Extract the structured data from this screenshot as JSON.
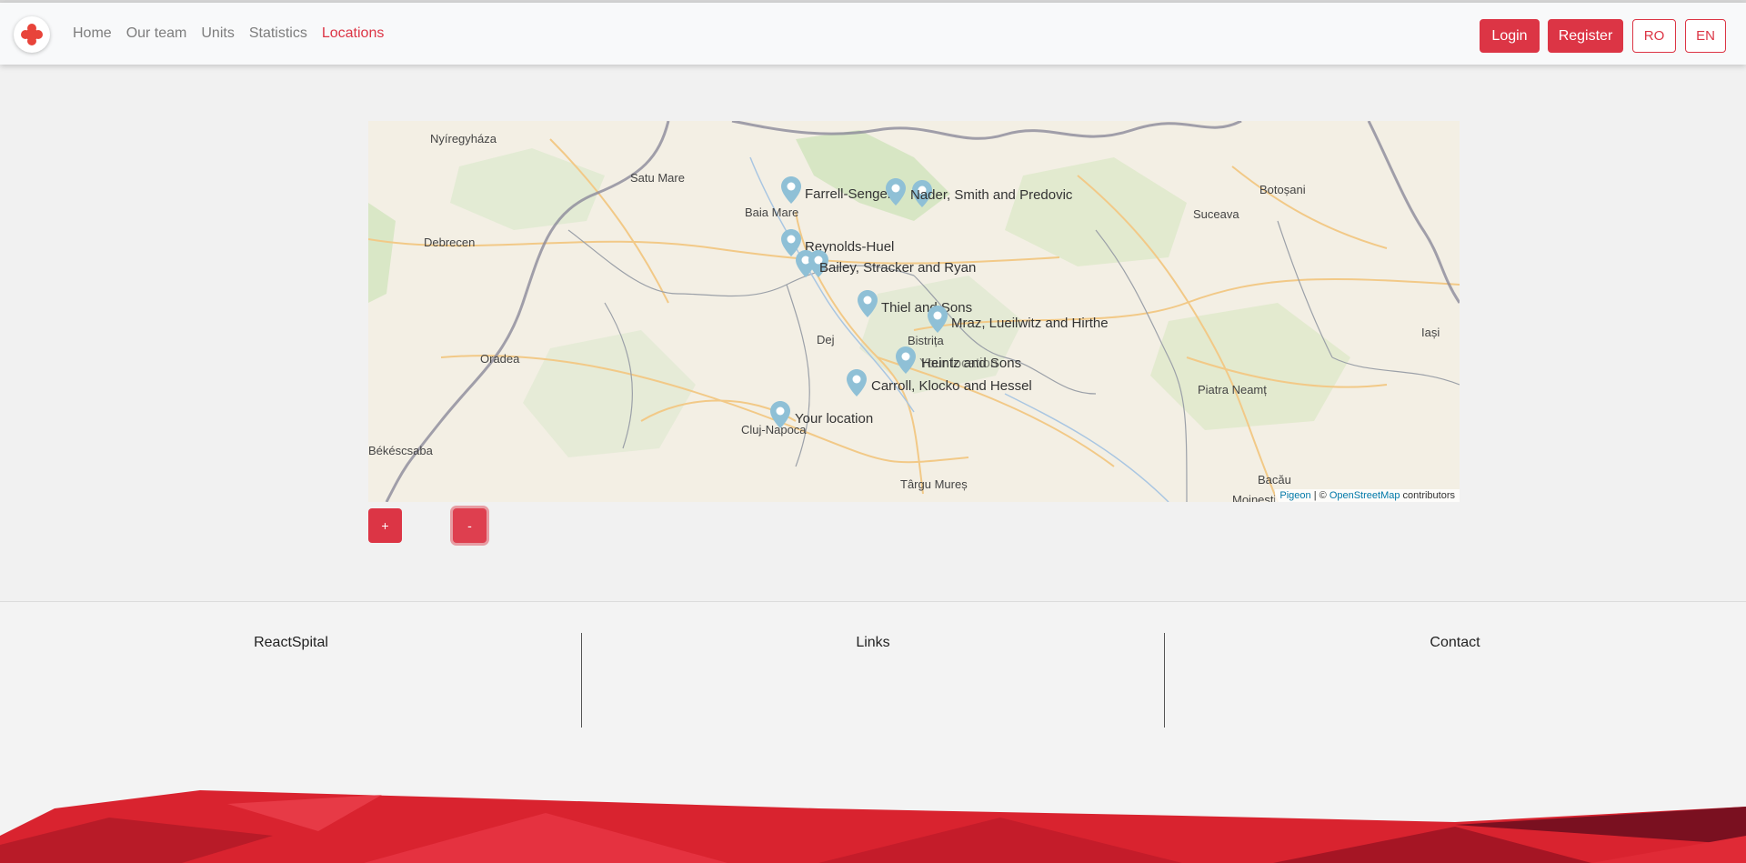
{
  "nav": {
    "links": [
      "Home",
      "Our team",
      "Units",
      "Statistics",
      "Locations"
    ],
    "active_index": 4,
    "login": "Login",
    "register": "Register",
    "lang_ro": "RO",
    "lang_en": "EN"
  },
  "map": {
    "cities": [
      "Nyíregyháza",
      "Satu Mare",
      "Baia Mare",
      "Debrecen",
      "Oradea",
      "Dej",
      "Bistrița",
      "Cluj-Napoca",
      "Târgu Mureș",
      "Suceava",
      "Botoșani",
      "Iași",
      "Piatra Neamț",
      "Bacău",
      "Moinești",
      "Békéscsaba"
    ],
    "markers": [
      "Farrell-Senger",
      "Nader, Smith and Predovic",
      "Reynolds-Huel",
      "Bailey, Stracker and Ryan",
      "Thiel and Sons",
      "Mraz, Lueilwitz and Hirthe",
      "Heintz and Sons",
      "Your location",
      "Carroll, Klocko and Hessel",
      "Your location"
    ],
    "attribution": {
      "pigeon": "Pigeon",
      "sep": " | © ",
      "osm": "OpenStreetMap",
      "suffix": " contributors"
    }
  },
  "zoom": {
    "in": "+",
    "out": "-"
  },
  "footer": {
    "col1": "ReactSpital",
    "col2": "Links",
    "col3": "Contact"
  },
  "colors": {
    "accent": "#dc3545",
    "marker": "#8fc0d6"
  }
}
